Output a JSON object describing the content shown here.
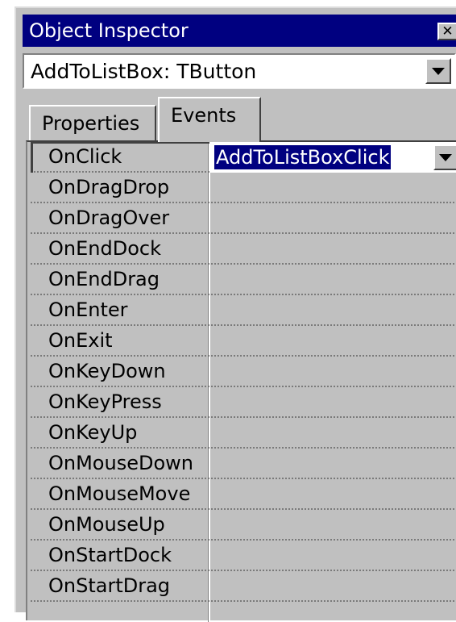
{
  "window": {
    "title": "Object Inspector",
    "close_glyph": "✕"
  },
  "object_selector": {
    "value": "AddToListBox: TButton"
  },
  "tabs": [
    {
      "label": "Properties",
      "active": false
    },
    {
      "label": "Events",
      "active": true
    }
  ],
  "events": [
    {
      "name": "OnClick",
      "value": "AddToListBoxClick",
      "selected": true
    },
    {
      "name": "OnDragDrop",
      "value": ""
    },
    {
      "name": "OnDragOver",
      "value": ""
    },
    {
      "name": "OnEndDock",
      "value": ""
    },
    {
      "name": "OnEndDrag",
      "value": ""
    },
    {
      "name": "OnEnter",
      "value": ""
    },
    {
      "name": "OnExit",
      "value": ""
    },
    {
      "name": "OnKeyDown",
      "value": ""
    },
    {
      "name": "OnKeyPress",
      "value": ""
    },
    {
      "name": "OnKeyUp",
      "value": ""
    },
    {
      "name": "OnMouseDown",
      "value": ""
    },
    {
      "name": "OnMouseMove",
      "value": ""
    },
    {
      "name": "OnMouseUp",
      "value": ""
    },
    {
      "name": "OnStartDock",
      "value": ""
    },
    {
      "name": "OnStartDrag",
      "value": ""
    }
  ],
  "colors": {
    "titlebar": "#000080",
    "face": "#c0c0c0",
    "selection": "#000080"
  },
  "icons": {
    "close": "close-icon",
    "dropdown": "chevron-down-icon"
  }
}
